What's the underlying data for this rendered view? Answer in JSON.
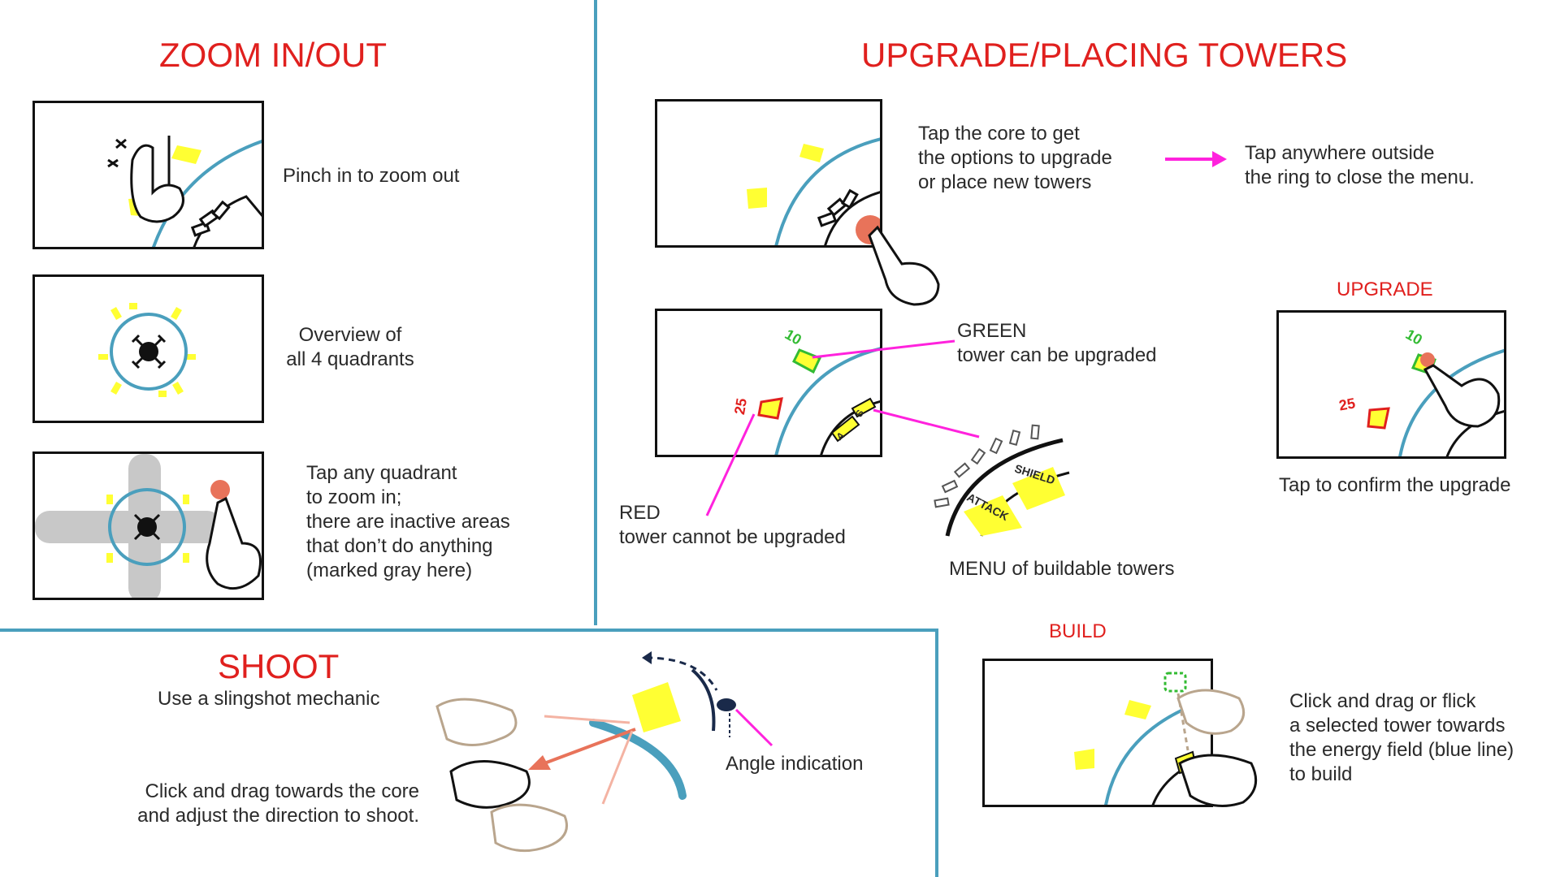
{
  "colors": {
    "title_red": "#e0201e",
    "divider_blue": "#4a9fbd",
    "energy_blue": "#4a9fbd",
    "tower_yellow": "#ffff33",
    "magenta": "#ff22dd",
    "core_red": "#e8735a",
    "inactive_gray": "#c8c8c8",
    "green_tower": "#33bb33"
  },
  "zoom": {
    "title": "ZOOM IN/OUT",
    "pinch_text": "Pinch in to zoom out",
    "overview_text": "Overview of\nall 4 quadrants",
    "tap_text": "Tap any quadrant\nto zoom in;\nthere are inactive areas\nthat don’t do anything\n(marked gray here)"
  },
  "upgrade": {
    "title": "UPGRADE/PLACING TOWERS",
    "tap_core_text": "Tap the core to get\nthe options to upgrade\nor place new towers",
    "close_text": "Tap anywhere outside\nthe ring to close the menu.",
    "green_text": "GREEN\ntower can be upgraded",
    "red_text": "RED\ntower cannot be upgraded",
    "menu_text": "MENU of buildable towers",
    "upgrade_label": "UPGRADE",
    "confirm_text": "Tap to confirm the upgrade",
    "cost_green": "10",
    "cost_red": "25",
    "menu_attack": "ATTACK",
    "menu_shield": "SHIELD",
    "mini_a": "A",
    "mini_s": "S"
  },
  "shoot": {
    "title": "SHOOT",
    "subtitle": "Use a slingshot mechanic",
    "drag_text": "Click and drag towards the core\nand adjust the direction to shoot.",
    "angle_text": "Angle indication"
  },
  "build": {
    "label": "BUILD",
    "text": "Click and drag or flick\na selected tower towards\nthe energy field (blue line)\nto build"
  }
}
